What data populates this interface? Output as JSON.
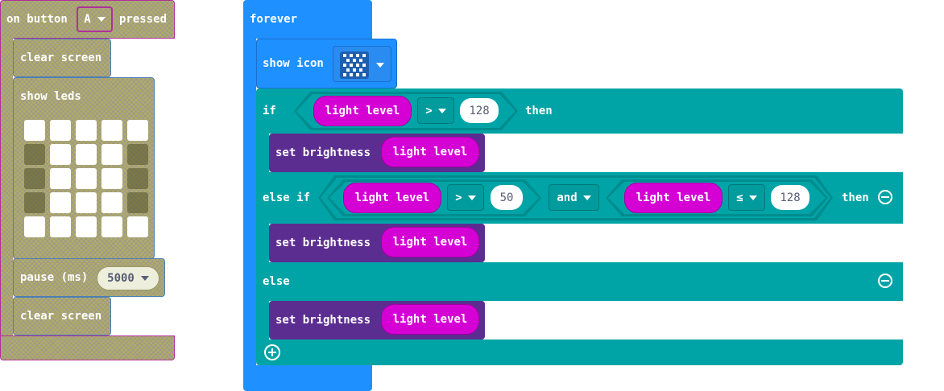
{
  "event_block": {
    "prefix": "on button",
    "button_value": "A",
    "suffix": "pressed",
    "clear_screen_1": "clear screen",
    "show_leds": "show leds",
    "leds": [
      [
        1,
        1,
        1,
        1,
        1
      ],
      [
        0,
        1,
        1,
        1,
        0
      ],
      [
        0,
        1,
        1,
        1,
        0
      ],
      [
        0,
        1,
        1,
        1,
        0
      ],
      [
        1,
        1,
        1,
        1,
        1
      ]
    ],
    "pause_label": "pause (ms)",
    "pause_value": "5000",
    "clear_screen_2": "clear screen"
  },
  "forever_block": {
    "label": "forever",
    "show_icon": "show icon",
    "if_label": "if",
    "then_label": "then",
    "elseif_label": "else if",
    "else_label": "else",
    "light_level": "light level",
    "set_brightness": "set brightness",
    "if_op": ">",
    "if_value": "128",
    "elseif_op1": ">",
    "elseif_value1": "50",
    "and_label": "and",
    "elseif_op2": "≤",
    "elseif_value2": "128"
  },
  "colors": {
    "disabled": "#b1ab66",
    "forever": "#1e90ff",
    "logic": "#00a4a6",
    "led": "#5c2d91",
    "input": "#d400d4"
  }
}
